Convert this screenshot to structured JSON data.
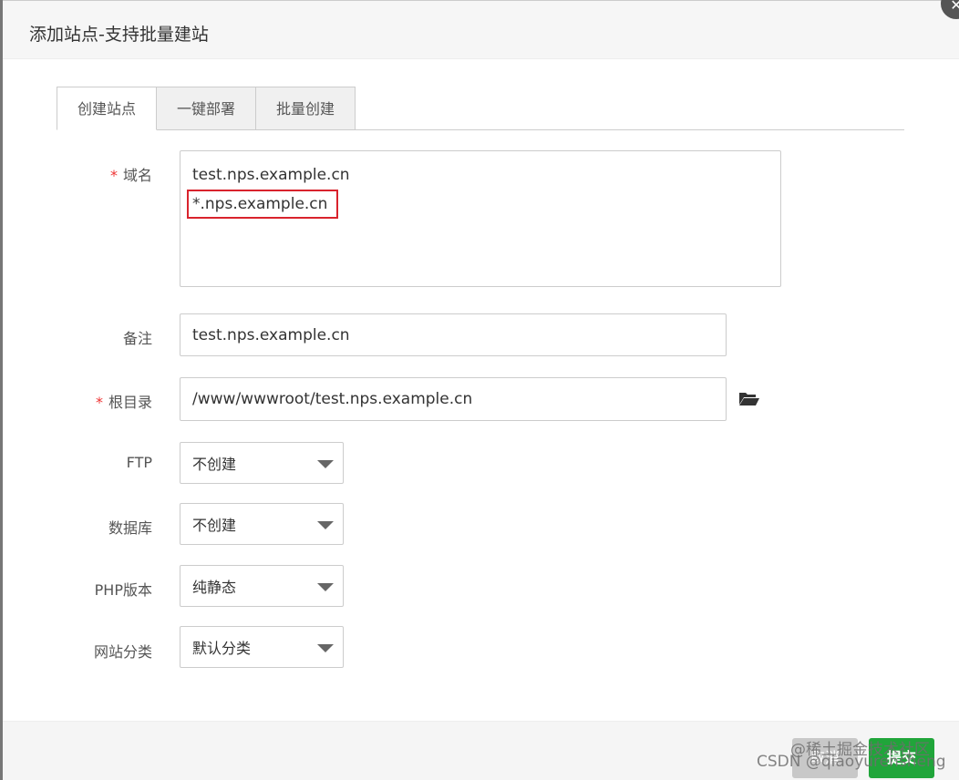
{
  "dialog": {
    "title": "添加站点-支持批量建站",
    "close_icon": "close-icon"
  },
  "tabs": [
    {
      "label": "创建站点",
      "active": true
    },
    {
      "label": "一键部署"
    },
    {
      "label": "批量创建"
    }
  ],
  "form": {
    "domain": {
      "label": "域名",
      "required_mark": "*",
      "lines": [
        "test.nps.example.cn",
        "*.nps.example.cn"
      ],
      "highlight_color": "#d9232d"
    },
    "remark": {
      "label": "备注",
      "value": "test.nps.example.cn"
    },
    "root": {
      "label": "根目录",
      "required_mark": "*",
      "value": "/www/wwwroot/test.nps.example.cn",
      "icon": "folder-open-icon"
    },
    "ftp": {
      "label": "FTP",
      "value": "不创建"
    },
    "database": {
      "label": "数据库",
      "value": "不创建"
    },
    "php": {
      "label": "PHP版本",
      "value": "纯静态"
    },
    "category": {
      "label": "网站分类",
      "value": "默认分类"
    }
  },
  "footer": {
    "cancel_label": "取消",
    "submit_label": "提交",
    "submit_color": "#20a53a"
  },
  "watermark": {
    "line1": "@稀土掘金技术社区",
    "line2": "CSDN @qiaoyurensheng"
  }
}
